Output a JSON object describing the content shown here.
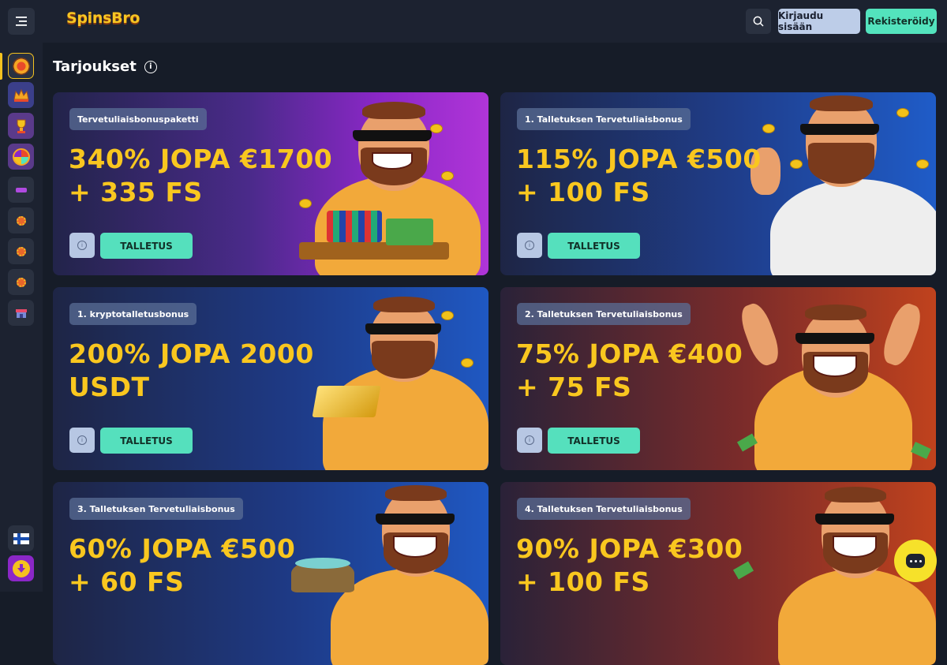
{
  "header": {
    "logo": "SpinsBro",
    "login_label": "Kirjaudu sisään",
    "register_label": "Rekisteröidy"
  },
  "page": {
    "title": "Tarjoukset"
  },
  "offers": [
    {
      "badge": "Tervetuliaisbonuspaketti",
      "line1": "340% JOPA €1700",
      "line2": "+ 335 FS",
      "button": "TALLETUS"
    },
    {
      "badge": "1. Talletuksen Tervetuliaisbonus",
      "line1": "115% JOPA €500",
      "line2": "+ 100 FS",
      "button": "TALLETUS"
    },
    {
      "badge": "1. kryptotalletusbonus",
      "line1": "200% JOPA 2000",
      "line2": "USDT",
      "button": "TALLETUS"
    },
    {
      "badge": "2. Talletuksen Tervetuliaisbonus",
      "line1": "75% JOPA €400",
      "line2": "+ 75 FS",
      "button": "TALLETUS"
    },
    {
      "badge": "3. Talletuksen Tervetuliaisbonus",
      "line1": "60% JOPA €500",
      "line2": "+ 60 FS",
      "button": "TALLETUS"
    },
    {
      "badge": "4. Talletuksen Tervetuliaisbonus",
      "line1": "90% JOPA €300",
      "line2": "+ 100 FS",
      "button": "TALLETUS"
    }
  ],
  "sidebar_icons": [
    "promotions-icon",
    "vip-crown-icon",
    "tournament-trophy-icon",
    "wheel-of-fortune-icon",
    "games-icon",
    "casino-chip-icon",
    "live-casino-icon",
    "jackpot-icon",
    "shop-icon",
    "finland-flag-icon",
    "download-app-icon"
  ],
  "colors": {
    "accent_yellow": "#f9c71f",
    "deposit_green": "#55e0bd",
    "login_blue": "#bdcde8",
    "background": "#161c28"
  }
}
